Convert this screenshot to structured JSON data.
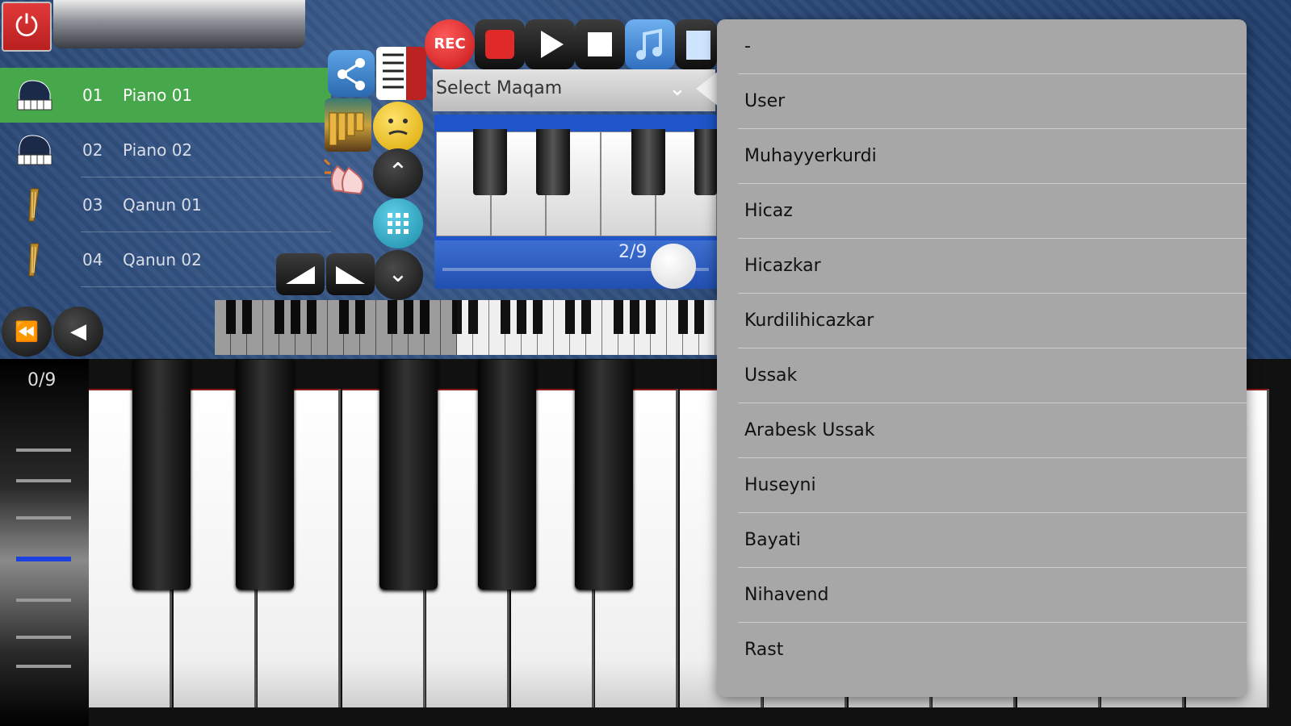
{
  "instruments": [
    {
      "num": "01",
      "name": "Piano 01",
      "icon": "grand-piano-icon",
      "selected": true
    },
    {
      "num": "02",
      "name": "Piano 02",
      "icon": "grand-piano-icon",
      "selected": false
    },
    {
      "num": "03",
      "name": "Qanun 01",
      "icon": "harp-icon",
      "selected": false
    },
    {
      "num": "04",
      "name": "Qanun 02",
      "icon": "harp-icon",
      "selected": false
    }
  ],
  "transport": {
    "rec_label": "REC"
  },
  "maqam_select": {
    "label": "Select Maqam"
  },
  "octave_slider": {
    "label": "2/9",
    "value": 2,
    "max": 9
  },
  "velocity": {
    "label": "0/9"
  },
  "dropdown": {
    "items": [
      "-",
      "User",
      "Muhayyerkurdi",
      "Hicaz",
      "Hicazkar",
      "Kurdilihicazkar",
      "Ussak",
      "Arabesk Ussak",
      "Huseyni",
      "Bayati",
      "Nihavend",
      "Rast"
    ]
  },
  "colors": {
    "selected_row": "#46a84a",
    "rec_red": "#d42a2a",
    "piano_blue": "#1f55c9",
    "dropdown_bg": "#a7a7a7"
  }
}
